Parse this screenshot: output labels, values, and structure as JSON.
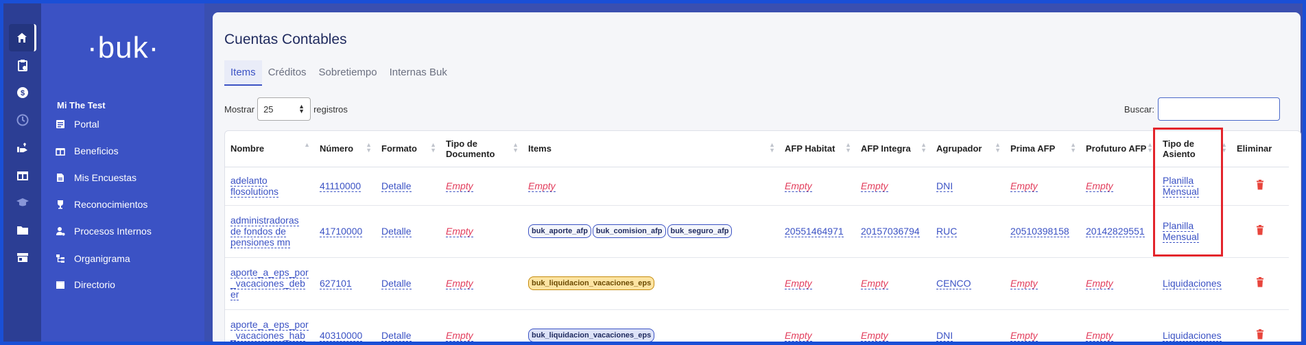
{
  "rail": [
    {
      "icon": "home-icon",
      "active": true
    },
    {
      "icon": "clipboard-icon",
      "active": false
    },
    {
      "icon": "dollar-icon",
      "active": false
    },
    {
      "icon": "clock-icon",
      "active": false,
      "dim": true
    },
    {
      "icon": "hand-heart-icon",
      "active": false
    },
    {
      "icon": "gift-icon",
      "active": false
    },
    {
      "icon": "graduation-icon",
      "active": false,
      "dim": true
    },
    {
      "icon": "folder-icon",
      "active": false
    },
    {
      "icon": "store-icon",
      "active": false
    }
  ],
  "sidebar": {
    "logo": "·buk·",
    "user": "Mi The Test",
    "items": [
      {
        "label": "Portal",
        "icon": "newspaper-icon"
      },
      {
        "label": "Beneficios",
        "icon": "gift-icon"
      },
      {
        "label": "Mis Encuestas",
        "icon": "document-icon"
      },
      {
        "label": "Reconocimientos",
        "icon": "trophy-icon"
      },
      {
        "label": "Procesos Internos",
        "icon": "user-gear-icon"
      },
      {
        "label": "Organigrama",
        "icon": "org-chart-icon"
      },
      {
        "label": "Directorio",
        "icon": "directory-icon"
      }
    ]
  },
  "page": {
    "title": "Cuentas Contables",
    "tabs": [
      "Items",
      "Créditos",
      "Sobretiempo",
      "Internas Buk"
    ],
    "active_tab": 0,
    "show_label": "Mostrar",
    "show_value": "25",
    "show_suffix": "registros",
    "search_label": "Buscar:",
    "search_value": ""
  },
  "table": {
    "columns": [
      "Nombre",
      "Número",
      "Formato",
      "Tipo de Documento",
      "Items",
      "AFP Habitat",
      "AFP Integra",
      "Agrupador",
      "Prima AFP",
      "Profuturo AFP",
      "Tipo de Asiento",
      "Eliminar"
    ],
    "rows": [
      {
        "nombre": "adelanto flosolutions",
        "numero": "41110000",
        "formato": "Detalle",
        "tipo_doc": "Empty",
        "items": [],
        "items_empty": "Empty",
        "habitat": "Empty",
        "integra": "Empty",
        "agrupador": "DNI",
        "prima": "Empty",
        "profuturo": "Empty",
        "asiento": "Planilla Mensual"
      },
      {
        "nombre": "administradoras de fondos de pensiones mn",
        "numero": "41710000",
        "formato": "Detalle",
        "tipo_doc": "Empty",
        "items": [
          "buk_aporte_afp",
          "buk_comision_afp",
          "buk_seguro_afp"
        ],
        "habitat": "20551464971",
        "integra": "20157036794",
        "agrupador": "RUC",
        "prima": "20510398158",
        "profuturo": "20142829551",
        "asiento": "Planilla Mensual"
      },
      {
        "nombre": "aporte_a_eps_por_vacaciones_deber",
        "numero": "627101",
        "formato": "Detalle",
        "tipo_doc": "Empty",
        "items": [
          "buk_liquidacion_vacaciones_eps"
        ],
        "badge_style": "yel",
        "habitat": "Empty",
        "integra": "Empty",
        "agrupador": "CENCO",
        "prima": "Empty",
        "profuturo": "Empty",
        "asiento": "Liquidaciones"
      },
      {
        "nombre": "aporte_a_eps_por_vacaciones_habe",
        "numero": "40310000",
        "formato": "Detalle",
        "tipo_doc": "Empty",
        "items": [
          "buk_liquidacion_vacaciones_eps"
        ],
        "badge_style": "lav",
        "habitat": "Empty",
        "integra": "Empty",
        "agrupador": "DNI",
        "prima": "Empty",
        "profuturo": "Empty",
        "asiento": "Liquidaciones"
      }
    ]
  },
  "colors": {
    "accent": "#3b52c4",
    "empty": "#e23c5b",
    "highlight": "#e3242b"
  }
}
